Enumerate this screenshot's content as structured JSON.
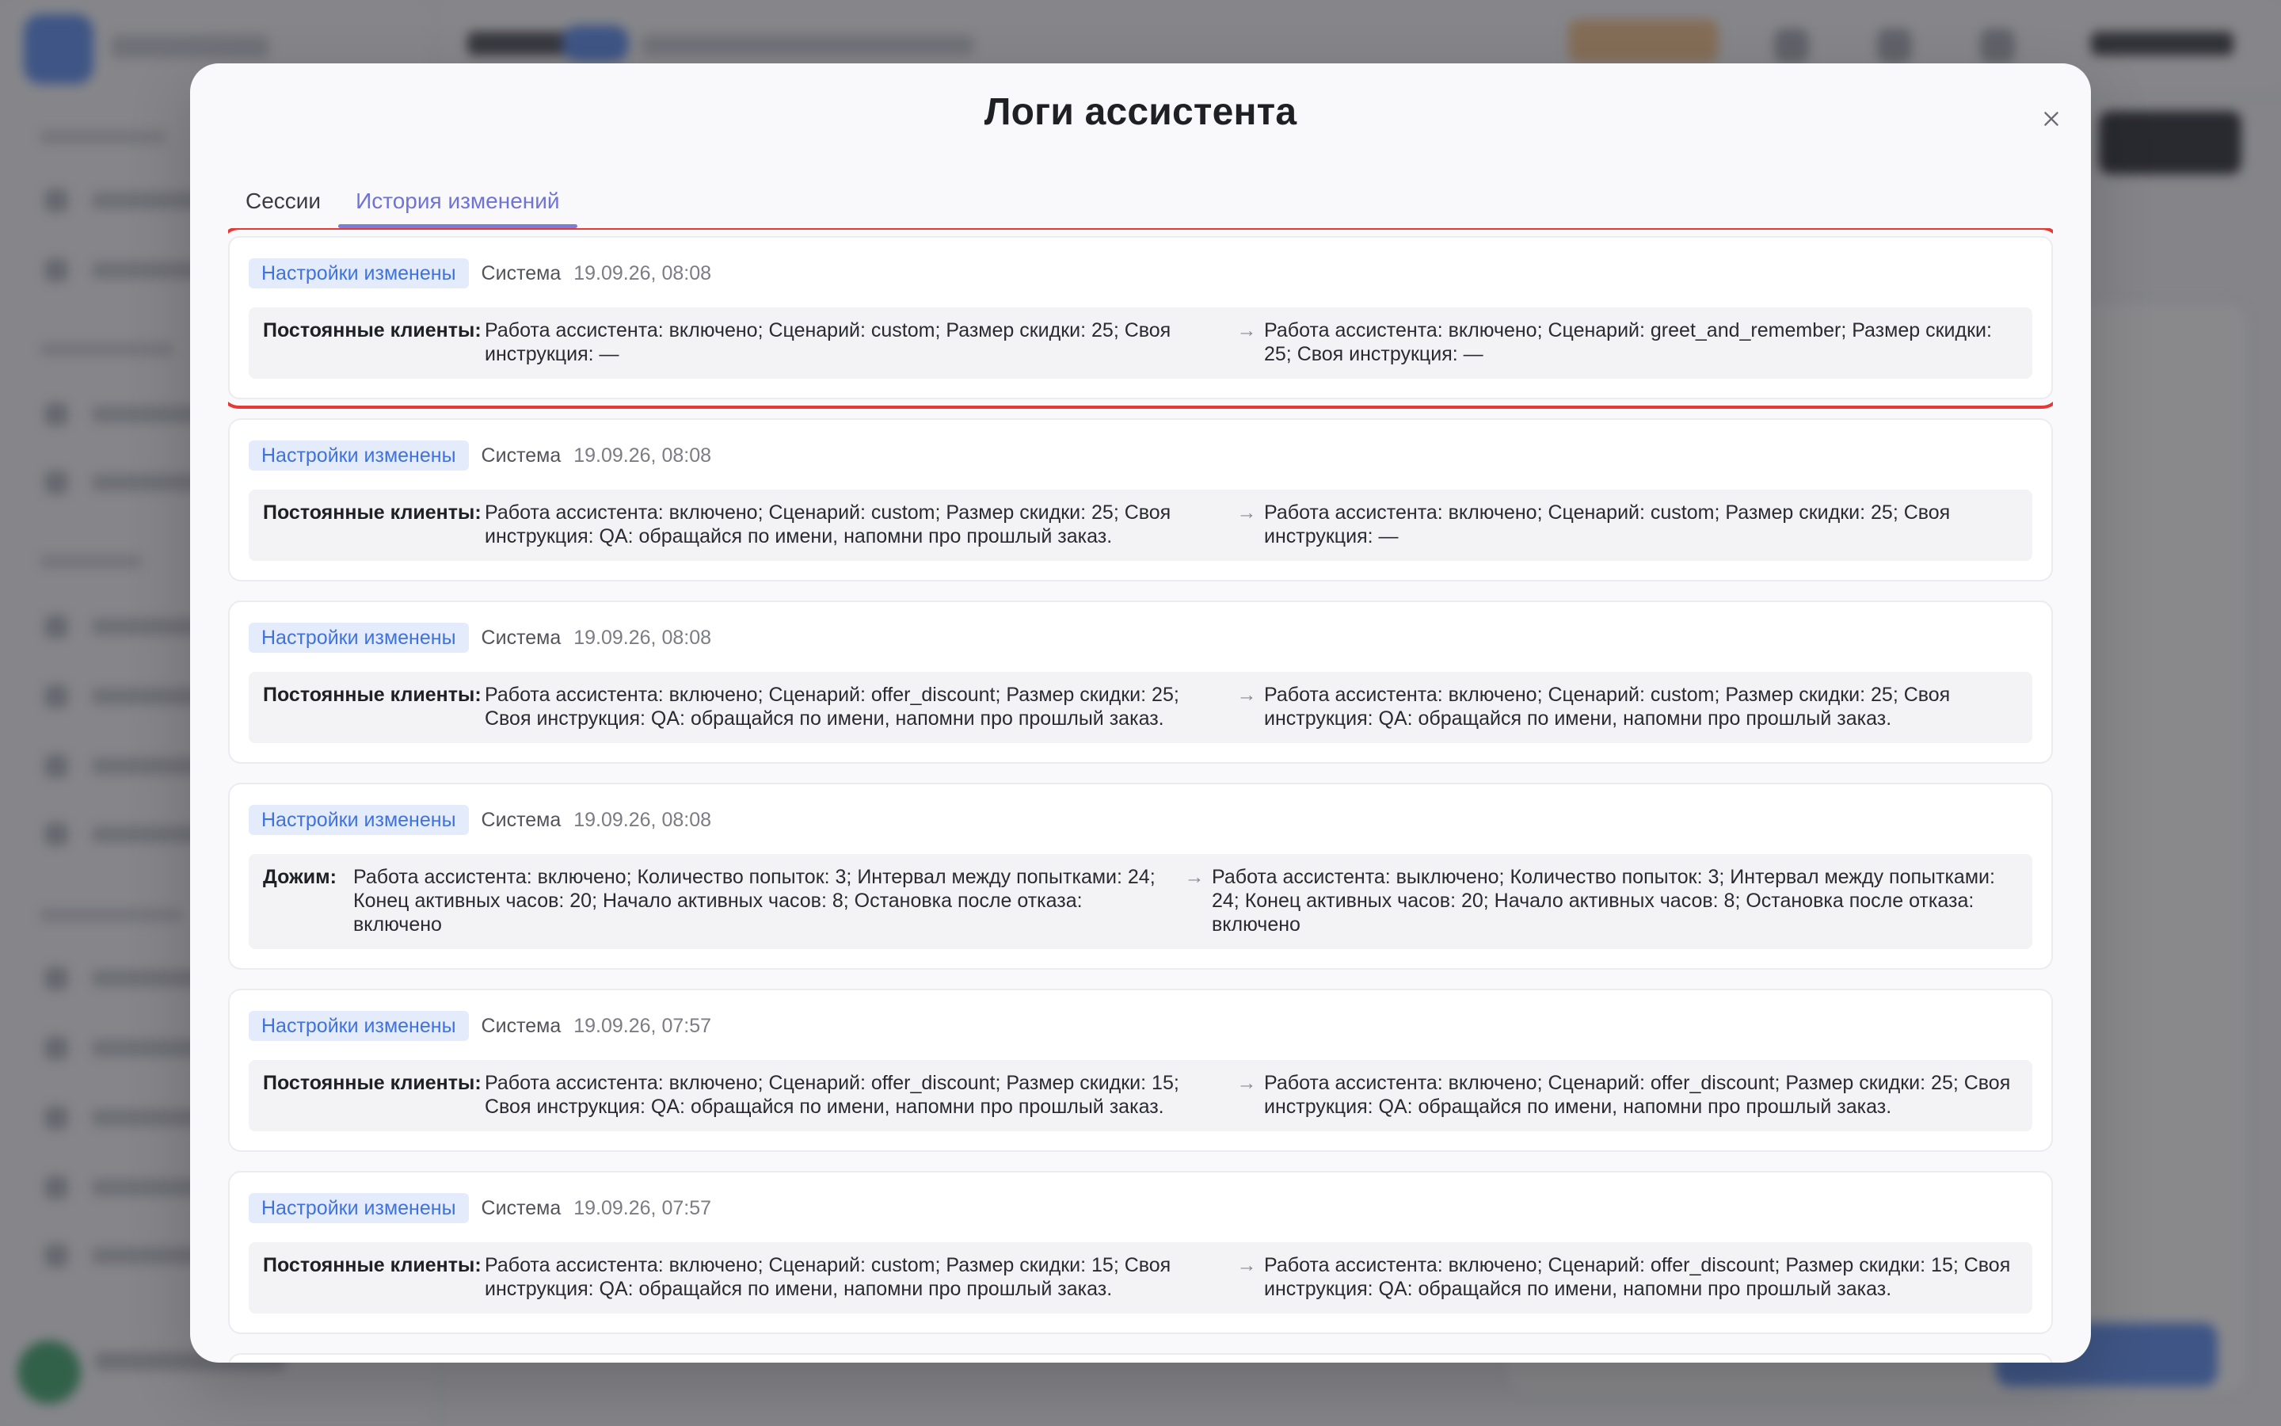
{
  "modal": {
    "title": "Логи ассистента",
    "close_icon": "close-icon",
    "tabs": [
      {
        "label": "Сессии",
        "active": false
      },
      {
        "label": "История изменений",
        "active": true
      }
    ]
  },
  "logs": [
    {
      "badge": "Настройки изменены",
      "source": "Система",
      "time": "19.09.26, 08:08",
      "label": "Постоянные клиенты:",
      "old": "Работа ассистента: включено; Сценарий: custom; Размер скидки: 25; Своя инструкция: —",
      "arrow": "→",
      "new": "Работа ассистента: включено; Сценарий: greet_and_remember; Размер скидки: 25; Своя инструкция: —"
    },
    {
      "badge": "Настройки изменены",
      "source": "Система",
      "time": "19.09.26, 08:08",
      "label": "Постоянные клиенты:",
      "old": "Работа ассистента: включено; Сценарий: custom; Размер скидки: 25; Своя инструкция: QA: обращайся по имени, напомни про прошлый заказ.",
      "arrow": "→",
      "new": "Работа ассистента: включено; Сценарий: custom; Размер скидки: 25; Своя инструкция: —"
    },
    {
      "badge": "Настройки изменены",
      "source": "Система",
      "time": "19.09.26, 08:08",
      "label": "Постоянные клиенты:",
      "old": "Работа ассистента: включено; Сценарий: offer_discount; Размер скидки: 25; Своя инструкция: QA: обращайся по имени, напомни про прошлый заказ.",
      "arrow": "→",
      "new": "Работа ассистента: включено; Сценарий: custom; Размер скидки: 25; Своя инструкция: QA: обращайся по имени, напомни про прошлый заказ."
    },
    {
      "badge": "Настройки изменены",
      "source": "Система",
      "time": "19.09.26, 08:08",
      "label": "Дожим:",
      "old": "Работа ассистента: включено; Количество попыток: 3; Интервал между попытками: 24; Конец активных часов: 20; Начало активных часов: 8; Остановка после отказа: включено",
      "arrow": "→",
      "new": "Работа ассистента: выключено; Количество попыток: 3; Интервал между попытками: 24; Конец активных часов: 20; Начало активных часов: 8; Остановка после отказа: включено"
    },
    {
      "badge": "Настройки изменены",
      "source": "Система",
      "time": "19.09.26, 07:57",
      "label": "Постоянные клиенты:",
      "old": "Работа ассистента: включено; Сценарий: offer_discount; Размер скидки: 15; Своя инструкция: QA: обращайся по имени, напомни про прошлый заказ.",
      "arrow": "→",
      "new": "Работа ассистента: включено; Сценарий: offer_discount; Размер скидки: 25; Своя инструкция: QA: обращайся по имени, напомни про прошлый заказ."
    },
    {
      "badge": "Настройки изменены",
      "source": "Система",
      "time": "19.09.26, 07:57",
      "label": "Постоянные клиенты:",
      "old": "Работа ассистента: включено; Сценарий: custom; Размер скидки: 15; Своя инструкция: QA: обращайся по имени, напомни про прошлый заказ.",
      "arrow": "→",
      "new": "Работа ассистента: включено; Сценарий: offer_discount; Размер скидки: 15; Своя инструкция: QA: обращайся по имени, напомни про прошлый заказ."
    }
  ]
}
